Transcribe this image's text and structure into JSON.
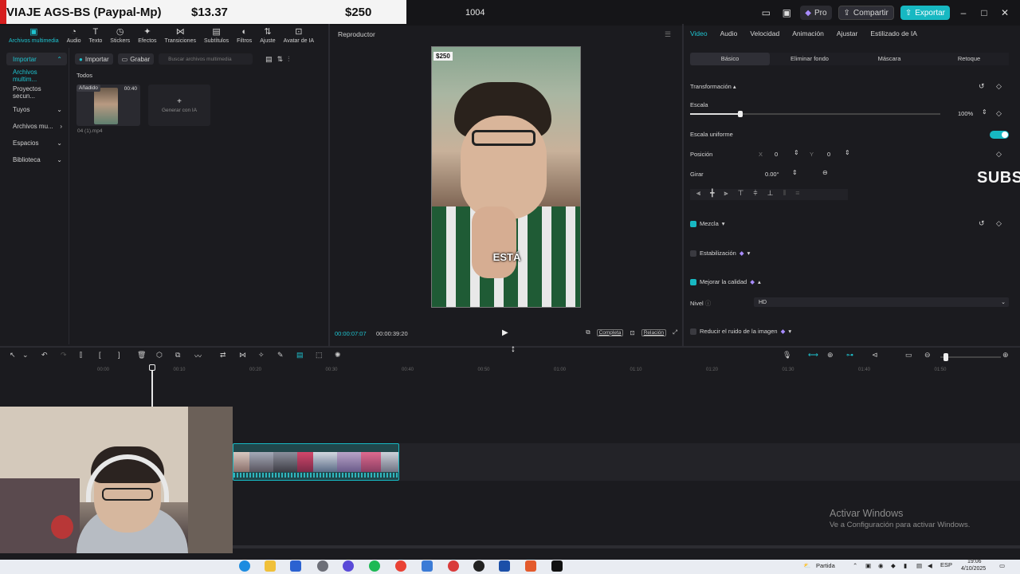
{
  "overlay": {
    "title": "VIAJE AGS-BS (Paypal-Mp)",
    "amount1": "$13.37",
    "amount2": "$250"
  },
  "titlebar": {
    "counter": "1004",
    "pro_label": "Pro",
    "share_label": "Compartir",
    "export_label": "Exportar"
  },
  "toolbar": {
    "items": [
      {
        "label": "Archivos multimedia",
        "icon": "media-icon"
      },
      {
        "label": "Audio",
        "icon": "audio-icon"
      },
      {
        "label": "Texto",
        "icon": "text-icon"
      },
      {
        "label": "Stickers",
        "icon": "sticker-icon"
      },
      {
        "label": "Efectos",
        "icon": "effects-icon"
      },
      {
        "label": "Transiciones",
        "icon": "transitions-icon"
      },
      {
        "label": "Subtítulos",
        "icon": "subtitles-icon"
      },
      {
        "label": "Filtros",
        "icon": "filters-icon"
      },
      {
        "label": "Ajuste",
        "icon": "adjust-icon"
      },
      {
        "label": "Avatar de IA",
        "icon": "avatar-icon"
      }
    ]
  },
  "leftnav": {
    "items": [
      "Importar",
      "Archivos multim...",
      "Proyectos secun...",
      "Tuyos",
      "Archivos mu...",
      "Espacios",
      "Biblioteca"
    ]
  },
  "media": {
    "import_label": "Importar",
    "record_label": "Grabar",
    "search_placeholder": "Buscar archivos multimedia",
    "section_label": "Todos",
    "clip": {
      "badge": "Añadido",
      "duration": "00:40",
      "name": "04 (1).mp4"
    },
    "generate_label": "Generar con IA"
  },
  "player": {
    "title": "Reproductor",
    "price_tag": "$250",
    "caption": "ESTÁ",
    "current_time": "00:00:07:07",
    "total_time": "00:00:39:20",
    "full_label": "Completa",
    "ratio_label": "Relación"
  },
  "rightpanel": {
    "tabs": [
      "Video",
      "Audio",
      "Velocidad",
      "Animación",
      "Ajustar",
      "Estilizado de IA"
    ],
    "subtabs": [
      "Básico",
      "Eliminar fondo",
      "Máscara",
      "Retoque"
    ],
    "transform_label": "Transformación",
    "scale_label": "Escala",
    "scale_value": "100%",
    "scale_fraction": 0.2,
    "uniform_label": "Escala uniforme",
    "position_label": "Posición",
    "pos_x_label": "X",
    "pos_x": "0",
    "pos_y_label": "Y",
    "pos_y": "0",
    "rotate_label": "Girar",
    "rotate_value": "0.00°",
    "blend_label": "Mezcla",
    "stabilize_label": "Estabilización",
    "enhance_label": "Mejorar la calidad",
    "level_label": "Nivel",
    "level_value": "HD",
    "noise_label": "Reducir el ruido de la imagen",
    "overlay_text": "SUBS"
  },
  "timeline": {
    "ruler": [
      "00:00",
      "00:10",
      "00:20",
      "00:30",
      "00:40",
      "00:50",
      "01:00",
      "01:10",
      "01:20",
      "01:30",
      "01:40",
      "01:50"
    ]
  },
  "watermark": {
    "line1": "Activar Windows",
    "line2": "Ve a Configuración para activar Windows."
  },
  "taskbar": {
    "weather": "Partida",
    "lang": "ESP",
    "time": "19:06",
    "date": "4/10/2025"
  }
}
